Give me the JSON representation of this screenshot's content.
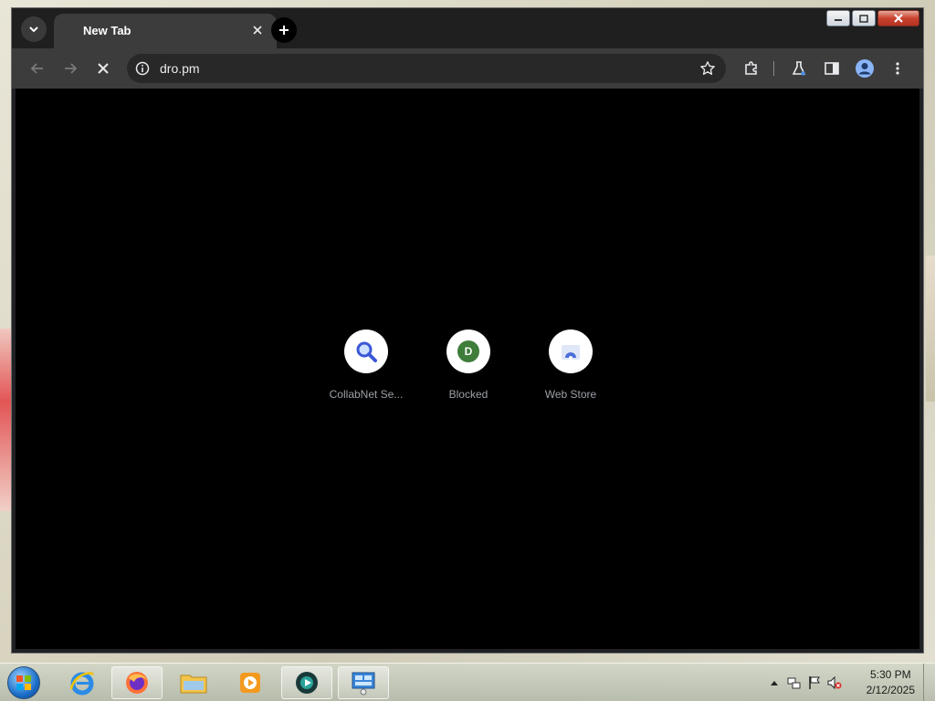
{
  "browser": {
    "tab": {
      "title": "New Tab"
    },
    "address_bar": {
      "url": "dro.pm"
    }
  },
  "shortcuts": [
    {
      "label": "CollabNet Se...",
      "icon": "search-icon",
      "icon_color": "#3a57d6"
    },
    {
      "label": "Blocked",
      "letter": "D",
      "icon_color": "#3f7d3a"
    },
    {
      "label": "Web Store",
      "icon": "web-store-icon",
      "icon_color": "#4a6fd8"
    }
  ],
  "taskbar": {
    "apps": [
      {
        "name": "internet-explorer"
      },
      {
        "name": "firefox"
      },
      {
        "name": "file-explorer"
      },
      {
        "name": "media-player"
      },
      {
        "name": "chrome-dev"
      },
      {
        "name": "remote-desktop"
      }
    ],
    "clock": {
      "time": "5:30 PM",
      "date": "2/12/2025"
    }
  },
  "colors": {
    "tab_active": "#3c3c3c",
    "toolbar": "#3c3c3c",
    "content_bg": "#000000",
    "close_button": "#c8432f"
  }
}
